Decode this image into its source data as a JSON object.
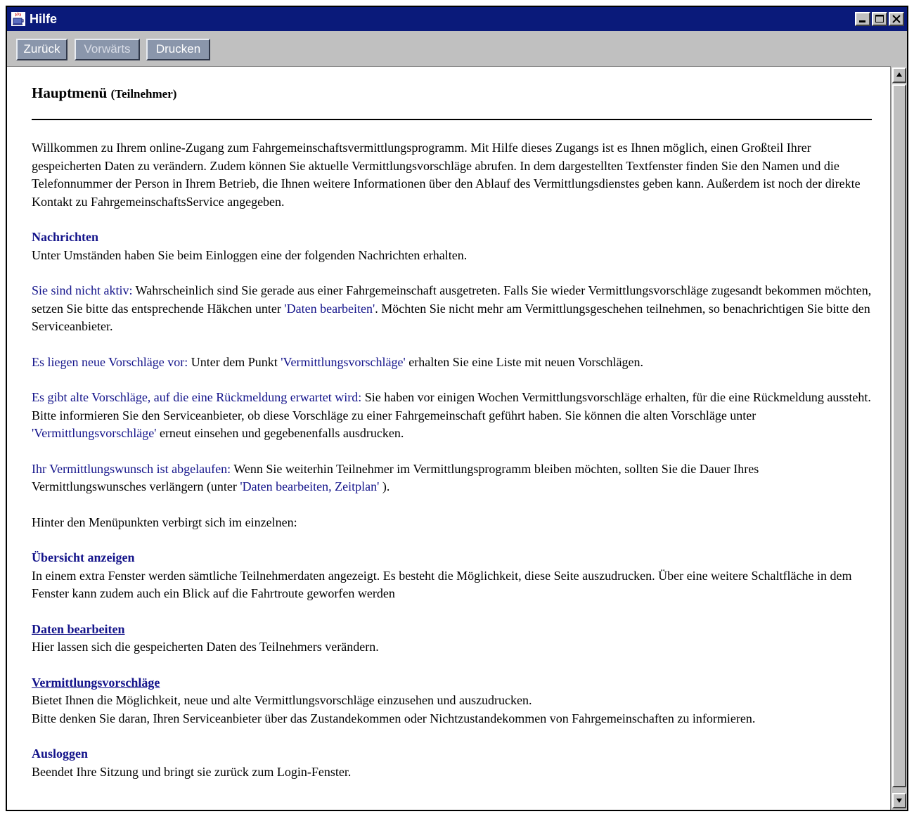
{
  "window": {
    "title": "Hilfe"
  },
  "toolbar": {
    "back": "Zurück",
    "forward": "Vorwärts",
    "print": "Drucken"
  },
  "doc": {
    "title_main": "Hauptmenü",
    "title_sub": "(Teilnehmer)",
    "intro": "Willkommen zu Ihrem online-Zugang zum Fahrgemeinschaftsvermittlungsprogramm. Mit Hilfe dieses Zugangs ist es Ihnen möglich, einen Großteil Ihrer gespeicherten Daten zu verändern. Zudem können Sie aktuelle Vermittlungsvorschläge abrufen. In dem dargestellten Textfenster finden Sie den Namen und die Telefonnummer der Person in Ihrem Betrieb, die Ihnen weitere Informationen über den Ablauf des Vermittlungsdienstes geben kann. Außerdem ist noch der direkte Kontakt zu FahrgemeinschaftsService angegeben.",
    "nachrichten": {
      "heading": "Nachrichten",
      "text": "Unter Umständen haben Sie beim Einloggen eine der folgenden Nachrichten erhalten."
    },
    "msg1": {
      "label": "Sie sind nicht aktiv:",
      "text_a": " Wahrscheinlich sind Sie gerade aus einer Fahrgemeinschaft ausgetreten. Falls Sie wieder Vermittlungsvorschläge zugesandt bekommen möchten, setzen Sie bitte das entsprechende Häkchen unter ",
      "ref": "'Daten bearbeiten'",
      "text_b": ". Möchten Sie nicht mehr am Vermittlungsgeschehen teilnehmen, so benachrichtigen Sie bitte den Serviceanbieter."
    },
    "msg2": {
      "label": "Es liegen neue Vorschläge vor:",
      "text_a": " Unter dem Punkt ",
      "ref": "'Vermittlungsvorschläge'",
      "text_b": " erhalten Sie eine Liste mit neuen Vorschlägen."
    },
    "msg3": {
      "label": "Es gibt alte Vorschläge, auf die eine Rückmeldung erwartet wird:",
      "text_a": " Sie haben vor einigen Wochen Vermittlungsvorschläge erhalten, für die eine Rückmeldung aussteht. Bitte informieren Sie den Serviceanbieter, ob diese Vorschläge zu einer Fahrgemeinschaft geführt haben. Sie können die alten Vorschläge unter ",
      "ref": "'Vermittlungsvorschläge'",
      "text_b": " erneut einsehen und gegebenenfalls ausdrucken."
    },
    "msg4": {
      "label": "Ihr Vermittlungswunsch ist abgelaufen:",
      "text_a": " Wenn Sie weiterhin Teilnehmer im Vermittlungsprogramm bleiben möchten, sollten Sie die Dauer Ihres Vermittlungswunsches verlängern (unter ",
      "ref": "'Daten bearbeiten, Zeitplan'",
      "text_b": " )."
    },
    "menu_intro": "Hinter den Menüpunkten verbirgt sich im einzelnen:",
    "uebersicht": {
      "heading": "Übersicht anzeigen",
      "text": "In einem extra Fenster werden sämtliche Teilnehmerdaten angezeigt. Es besteht die Möglichkeit, diese Seite auszudrucken. Über eine weitere Schaltfläche in dem Fenster kann zudem auch ein Blick auf die Fahrtroute geworfen werden"
    },
    "daten": {
      "heading": "Daten bearbeiten",
      "text": "Hier lassen sich die gespeicherten Daten des Teilnehmers verändern."
    },
    "vorschlaege": {
      "heading": "Vermittlungsvorschläge",
      "text_1": "Bietet Ihnen die Möglichkeit, neue und alte Vermittlungsvorschläge einzusehen und auszudrucken.",
      "text_2": "Bitte denken Sie daran, Ihren Serviceanbieter über das Zustandekommen oder Nichtzustandekommen von Fahrgemeinschaften zu informieren."
    },
    "ausloggen": {
      "heading": "Ausloggen",
      "text": "Beendet Ihre Sitzung und bringt sie zurück zum Login-Fenster."
    }
  }
}
